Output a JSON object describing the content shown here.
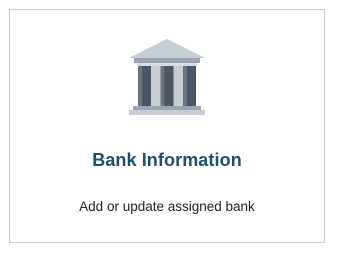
{
  "card": {
    "icon": "bank-icon",
    "title": "Bank Information",
    "description": "Add or update assigned bank"
  },
  "colors": {
    "title": "#1d4f6e",
    "icon_column": "#4d5663",
    "icon_light": "#c8ccd3",
    "border": "#c9c9c9"
  }
}
